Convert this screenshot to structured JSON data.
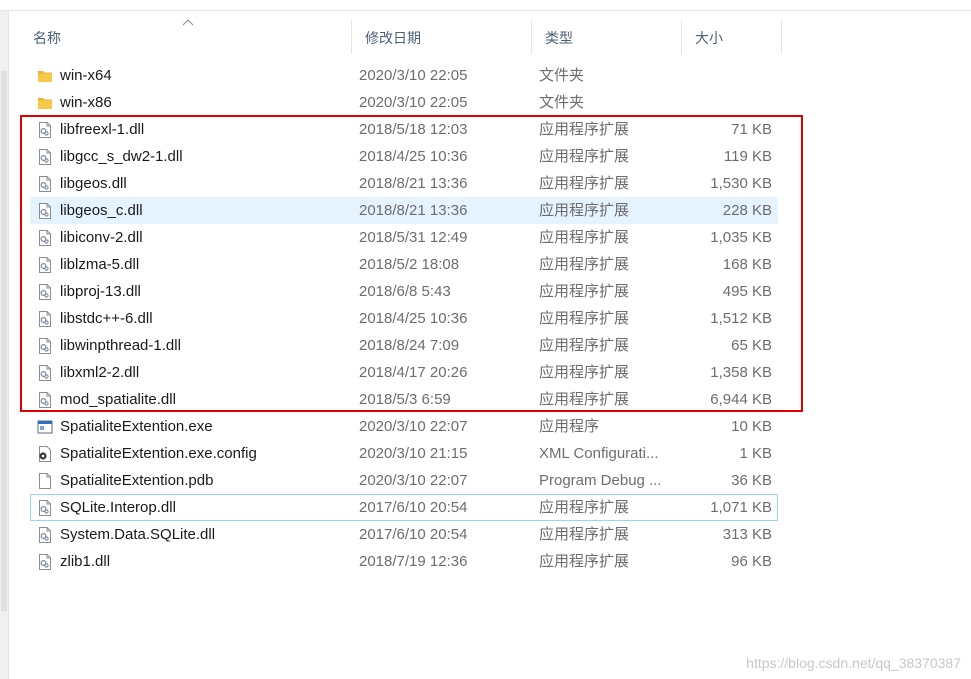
{
  "header": {
    "name": "名称",
    "date": "修改日期",
    "type": "类型",
    "size": "大小"
  },
  "files": [
    {
      "name": "win-x64",
      "date": "2020/3/10 22:05",
      "type": "文件夹",
      "size": "",
      "icon": "folder-icon"
    },
    {
      "name": "win-x86",
      "date": "2020/3/10 22:05",
      "type": "文件夹",
      "size": "",
      "icon": "folder-icon"
    },
    {
      "name": "libfreexl-1.dll",
      "date": "2018/5/18 12:03",
      "type": "应用程序扩展",
      "size": "71 KB",
      "icon": "dll-file-icon"
    },
    {
      "name": "libgcc_s_dw2-1.dll",
      "date": "2018/4/25 10:36",
      "type": "应用程序扩展",
      "size": "119 KB",
      "icon": "dll-file-icon"
    },
    {
      "name": "libgeos.dll",
      "date": "2018/8/21 13:36",
      "type": "应用程序扩展",
      "size": "1,530 KB",
      "icon": "dll-file-icon"
    },
    {
      "name": "libgeos_c.dll",
      "date": "2018/8/21 13:36",
      "type": "应用程序扩展",
      "size": "228 KB",
      "icon": "dll-file-icon",
      "state": "hover"
    },
    {
      "name": "libiconv-2.dll",
      "date": "2018/5/31 12:49",
      "type": "应用程序扩展",
      "size": "1,035 KB",
      "icon": "dll-file-icon"
    },
    {
      "name": "liblzma-5.dll",
      "date": "2018/5/2 18:08",
      "type": "应用程序扩展",
      "size": "168 KB",
      "icon": "dll-file-icon"
    },
    {
      "name": "libproj-13.dll",
      "date": "2018/6/8 5:43",
      "type": "应用程序扩展",
      "size": "495 KB",
      "icon": "dll-file-icon"
    },
    {
      "name": "libstdc++-6.dll",
      "date": "2018/4/25 10:36",
      "type": "应用程序扩展",
      "size": "1,512 KB",
      "icon": "dll-file-icon"
    },
    {
      "name": "libwinpthread-1.dll",
      "date": "2018/8/24 7:09",
      "type": "应用程序扩展",
      "size": "65 KB",
      "icon": "dll-file-icon"
    },
    {
      "name": "libxml2-2.dll",
      "date": "2018/4/17 20:26",
      "type": "应用程序扩展",
      "size": "1,358 KB",
      "icon": "dll-file-icon"
    },
    {
      "name": "mod_spatialite.dll",
      "date": "2018/5/3 6:59",
      "type": "应用程序扩展",
      "size": "6,944 KB",
      "icon": "dll-file-icon"
    },
    {
      "name": "SpatialiteExtention.exe",
      "date": "2020/3/10 22:07",
      "type": "应用程序",
      "size": "10 KB",
      "icon": "exe-file-icon"
    },
    {
      "name": "SpatialiteExtention.exe.config",
      "date": "2020/3/10 21:15",
      "type": "XML Configurati...",
      "size": "1 KB",
      "icon": "config-file-icon"
    },
    {
      "name": "SpatialiteExtention.pdb",
      "date": "2020/3/10 22:07",
      "type": "Program Debug ...",
      "size": "36 KB",
      "icon": "blank-file-icon"
    },
    {
      "name": "SQLite.Interop.dll",
      "date": "2017/6/10 20:54",
      "type": "应用程序扩展",
      "size": "1,071 KB",
      "icon": "dll-file-icon",
      "state": "focus"
    },
    {
      "name": "System.Data.SQLite.dll",
      "date": "2017/6/10 20:54",
      "type": "应用程序扩展",
      "size": "313 KB",
      "icon": "dll-file-icon"
    },
    {
      "name": "zlib1.dll",
      "date": "2018/7/19 12:36",
      "type": "应用程序扩展",
      "size": "96 KB",
      "icon": "dll-file-icon"
    }
  ],
  "watermark": "https://blog.csdn.net/qq_38370387",
  "colors": {
    "highlight_border": "#e00000",
    "hover_row": "#e5f3ff",
    "focus_row_border": "#99d1ff",
    "folder": "#f8c948"
  }
}
